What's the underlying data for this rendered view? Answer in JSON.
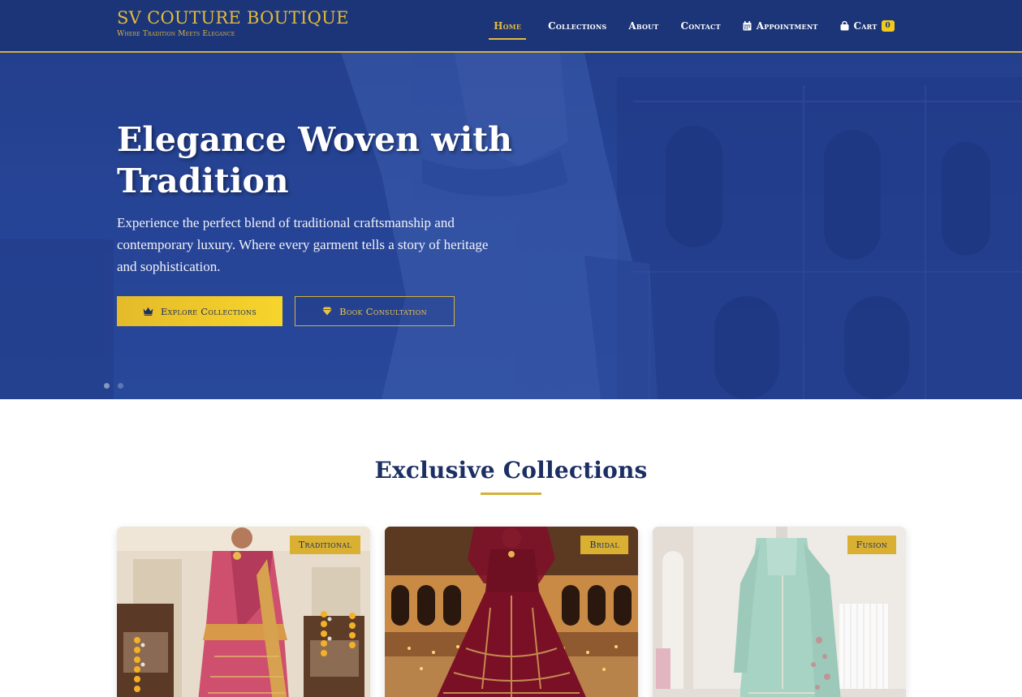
{
  "brand": {
    "name": "SV COUTURE BOUTIQUE",
    "tagline": "Where Tradition Meets Elegance"
  },
  "nav": {
    "home": "Home",
    "collections": "Collections",
    "about": "About",
    "contact": "Contact",
    "appointment": "Appointment",
    "cart": "Cart",
    "cart_count": "0",
    "active": "home"
  },
  "hero": {
    "title": "Elegance Woven with Tradition",
    "text": "Experience the perfect blend of traditional craftsmanship and contemporary luxury. Where every garment tells a story of heritage and sophistication.",
    "primary_button": "Explore Collections",
    "secondary_button": "Book Consultation",
    "slide_count": 2,
    "active_slide": 1
  },
  "collections": {
    "title": "Exclusive Collections",
    "cards": [
      {
        "badge": "Traditional",
        "image_icon": "saree-image"
      },
      {
        "badge": "Bridal",
        "image_icon": "lehenga-image"
      },
      {
        "badge": "Fusion",
        "image_icon": "fusion-outfit-image"
      }
    ]
  },
  "colors": {
    "primary": "#1c3578",
    "accent": "#d4b23a",
    "accent_bright": "#f3c91c",
    "heading": "#1c2f63"
  }
}
